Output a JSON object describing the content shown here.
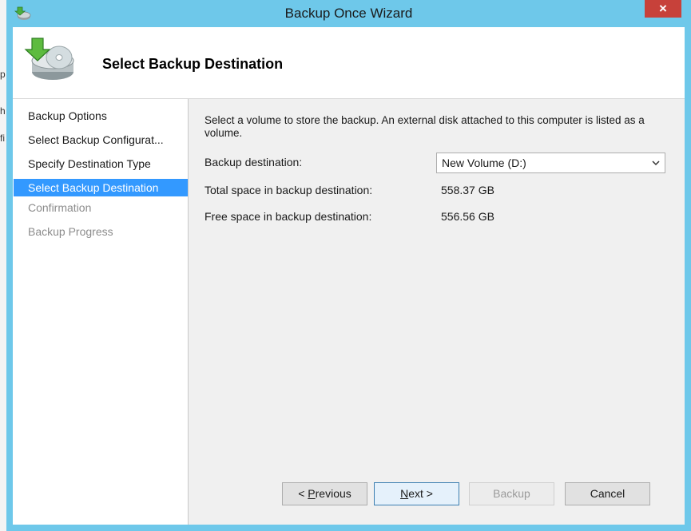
{
  "window": {
    "title": "Backup Once Wizard",
    "close_glyph": "×",
    "icon": "backup-app-icon"
  },
  "header": {
    "title": "Select Backup Destination",
    "icon": "backup-disk-icon"
  },
  "nav": {
    "items": [
      {
        "label": "Backup Options",
        "state": "normal"
      },
      {
        "label": "Select Backup Configurat...",
        "state": "normal"
      },
      {
        "label": "Specify Destination Type",
        "state": "normal"
      },
      {
        "label": "Select Backup Destination",
        "state": "active"
      },
      {
        "label": "Confirmation",
        "state": "disabled"
      },
      {
        "label": "Backup Progress",
        "state": "disabled"
      }
    ]
  },
  "main": {
    "description": "Select a volume to store the backup. An external disk attached to this computer is listed as a volume.",
    "destination_label": "Backup destination:",
    "destination_value": "New Volume (D:)",
    "total_label": "Total space in backup destination:",
    "total_value": "558.37 GB",
    "free_label": "Free space in backup destination:",
    "free_value": "556.56 GB"
  },
  "buttons": {
    "previous": {
      "pre": "< ",
      "mnemonic": "P",
      "rest": "revious"
    },
    "next": {
      "pre": "",
      "mnemonic": "N",
      "rest": "ext >"
    },
    "backup": {
      "pre": "",
      "mnemonic": "",
      "rest": "Backup"
    },
    "cancel": {
      "label": "Cancel"
    }
  },
  "background_letters": [
    "h",
    "p",
    "h",
    "fi"
  ],
  "colors": {
    "titlebar": "#6ec8ea",
    "close": "#c7413a",
    "selection": "#3399ff"
  }
}
